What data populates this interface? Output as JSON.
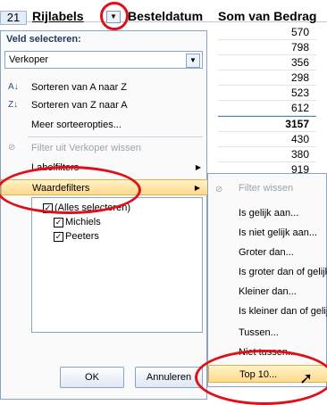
{
  "header": {
    "row_number": "21",
    "col_a": "Rijlabels",
    "col_b": "Besteldatum",
    "col_c": "Som van Bedrag"
  },
  "values": [
    "570",
    "798",
    "356",
    "298",
    "523",
    "612",
    "3157",
    "430",
    "380",
    "919"
  ],
  "menu": {
    "title": "Veld selecteren:",
    "field_value": "Verkoper",
    "sort_az": "Sorteren van A naar Z",
    "sort_za": "Sorteren van Z naar A",
    "more_sort": "Meer sorteeropties...",
    "clear_filter": "Filter uit Verkoper wissen",
    "label_filters": "Labelfilters",
    "value_filters": "Waardefilters",
    "items": [
      {
        "label": "(Alles selecteren)",
        "checked": true
      },
      {
        "label": "Michiels",
        "checked": true
      },
      {
        "label": "Peeters",
        "checked": true
      }
    ],
    "ok": "OK",
    "cancel": "Annuleren"
  },
  "submenu": {
    "clear": "Filter wissen",
    "equals": "Is gelijk aan...",
    "not_equals": "Is niet gelijk aan...",
    "greater": "Groter dan...",
    "greater_equal": "Is groter dan of gelijk aan...",
    "less": "Kleiner dan...",
    "less_equal": "Is kleiner dan of gelijk aan...",
    "between": "Tussen...",
    "not_between": "Niet tussen...",
    "top10": "Top 10..."
  }
}
